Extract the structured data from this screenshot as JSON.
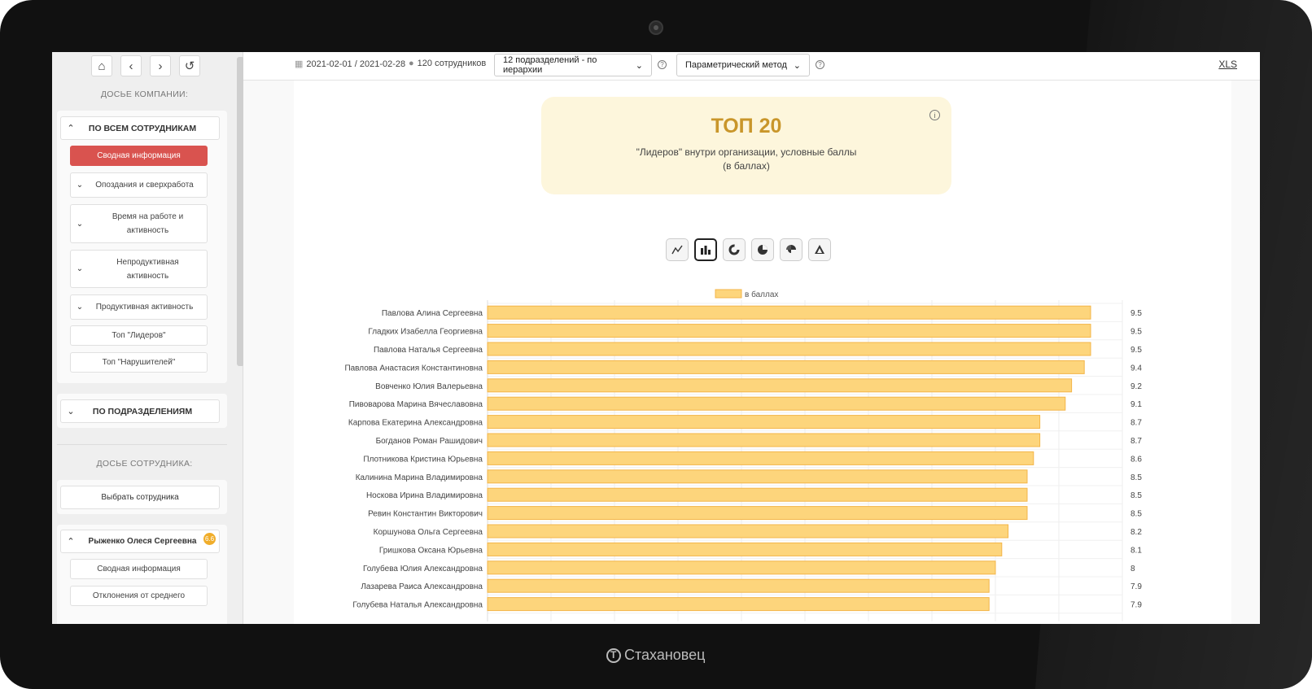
{
  "brand": {
    "name": "Стахановец"
  },
  "sidebar": {
    "nav_icons": [
      "home-icon",
      "chevron-left-icon",
      "chevron-right-icon",
      "undo-icon"
    ],
    "company_heading": "ДОСЬЕ КОМПАНИИ:",
    "all_employees": {
      "label": "ПО ВСЕМ СОТРУДНИКАМ",
      "items": [
        {
          "label": "Сводная информация",
          "active": true
        },
        {
          "label": "Опоздания и сверхработа"
        },
        {
          "label": "Время на работе и активность"
        },
        {
          "label": "Непродуктивная активность"
        },
        {
          "label": "Продуктивная активность"
        },
        {
          "label": "Топ \"Лидеров\""
        },
        {
          "label": "Топ \"Нарушителей\""
        }
      ]
    },
    "departments": {
      "label": "ПО ПОДРАЗДЕЛЕНИЯМ"
    },
    "employee_heading": "ДОСЬЕ СОТРУДНИКА:",
    "select_employee": "Выбрать сотрудника",
    "employee": {
      "name": "Рыженко Олеся Сергеевна",
      "badge": "6.6",
      "items": [
        {
          "label": "Сводная информация"
        },
        {
          "label": "Отклонения от среднего"
        }
      ]
    }
  },
  "toolbar": {
    "date_range": "2021-02-01 / 2021-02-28",
    "employees": "120 сотрудников",
    "department_select": "12 подразделений - по иерархии",
    "method_select": "Параметрический метод",
    "xls": "XLS"
  },
  "top_card": {
    "title": "ТОП 20",
    "subtitle": "\"Лидеров\" внутри организации, условные баллы",
    "subtitle2": "(в баллах)"
  },
  "chart_types": [
    "line-chart-icon",
    "bar-chart-icon",
    "donut-chart-icon",
    "pie-chart-icon",
    "polar-chart-icon",
    "radar-chart-icon"
  ],
  "colors": {
    "bar_fill": "#fdd57c",
    "bar_stroke": "#f3b548",
    "accent_red": "#d9534f",
    "title_gold": "#c9962a",
    "badge": "#f0ad2a"
  },
  "chart_data": {
    "type": "bar",
    "orientation": "horizontal",
    "legend": "в баллах",
    "categories": [
      "Павлова Алина Сергеевна",
      "Гладких Изабелла Георгиевна",
      "Павлова Наталья Сергеевна",
      "Павлова Анастасия Константиновна",
      "Вовченко Юлия Валерьевна",
      "Пивоварова Марина Вячеславовна",
      "Карпова Екатерина Александровна",
      "Богданов Роман Рашидович",
      "Плотникова Кристина Юрьевна",
      "Калинина Марина Владимировна",
      "Носкова Ирина Владимировна",
      "Ревин Константин Викторович",
      "Коршунова Ольга Сергеевна",
      "Гришкова Оксана Юрьевна",
      "Голубева Юлия Александровна",
      "Лазарева Раиса Александровна",
      "Голубева Наталья Александровна"
    ],
    "values": [
      9.5,
      9.5,
      9.5,
      9.4,
      9.2,
      9.1,
      8.7,
      8.7,
      8.6,
      8.5,
      8.5,
      8.5,
      8.2,
      8.1,
      8,
      7.9,
      7.9
    ],
    "xlim": [
      0,
      10
    ],
    "grid": true
  }
}
